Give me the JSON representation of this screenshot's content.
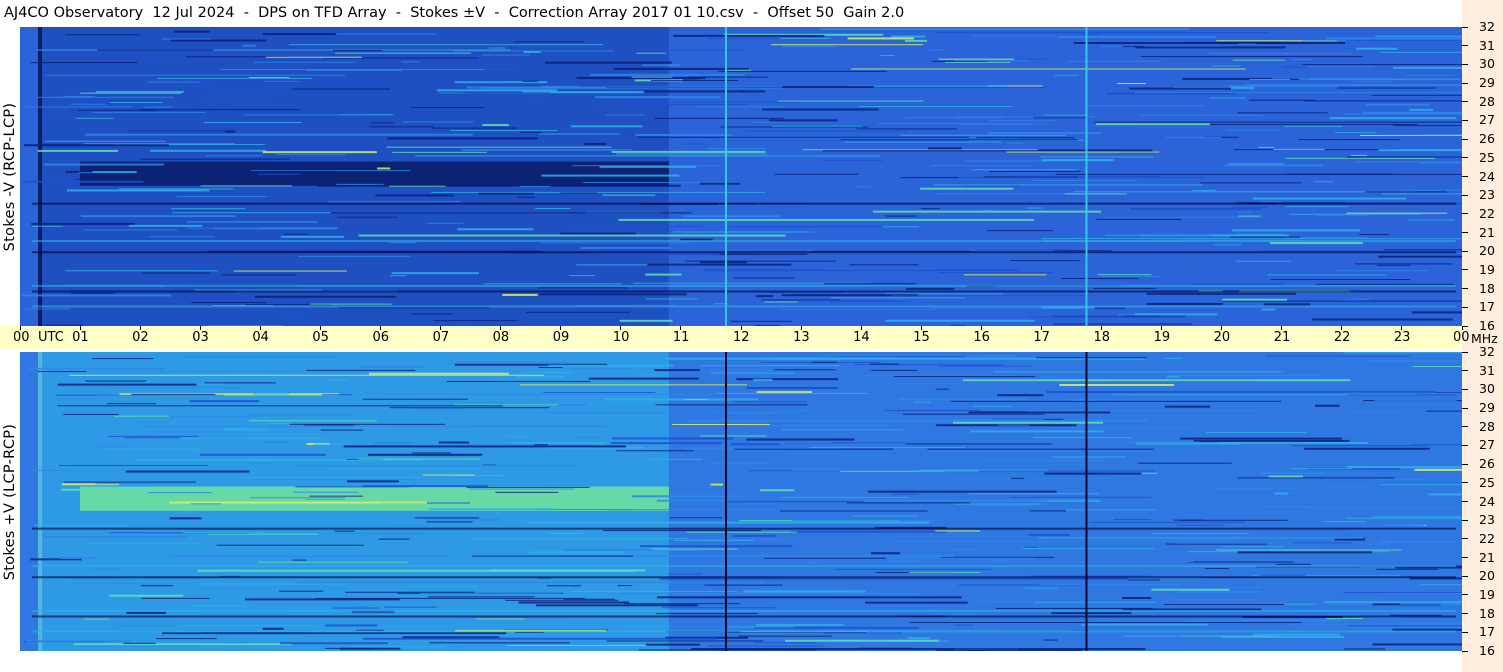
{
  "title": "AJ4CO Observatory  12 Jul 2024  -  DPS on TFD Array  -  Stokes ±V  -  Correction Array 2017 01 10.csv  -  Offset 50  Gain 2.0",
  "colors": {
    "background": "#ffffff",
    "time_axis_bg": "#ffffc8",
    "freq_axis_bg": "#ffeedd",
    "colormap": [
      "#000033",
      "#0a1e7a",
      "#1f4fd0",
      "#2e86ea",
      "#30b0e6",
      "#5ee0b0",
      "#d8f060",
      "#ff40c0"
    ]
  },
  "chart_data": [
    {
      "type": "heatmap",
      "title": "Stokes -V (RCP-LCP)",
      "ylabel": "Stokes -V (RCP-LCP)",
      "x_ticks": [
        "00",
        "01",
        "02",
        "03",
        "04",
        "05",
        "06",
        "07",
        "08",
        "09",
        "10",
        "11",
        "12",
        "13",
        "14",
        "15",
        "16",
        "17",
        "18",
        "19",
        "20",
        "21",
        "22",
        "23",
        "00"
      ],
      "x_unit": "UTC",
      "y_ticks": [
        16,
        17,
        18,
        19,
        20,
        21,
        22,
        23,
        24,
        25,
        26,
        27,
        28,
        29,
        30,
        31,
        32
      ],
      "y_unit": "MHz",
      "xlim": [
        0,
        24
      ],
      "ylim": [
        16,
        32
      ],
      "vertical_markers_utc": [
        11.75,
        17.75
      ],
      "features": {
        "dark_band_utc": [
          1.0,
          10.8
        ],
        "dark_band_mhz": [
          23.5,
          24.8
        ],
        "scan_transition_utc": 10.8
      }
    },
    {
      "type": "heatmap",
      "title": "Stokes +V (LCP-RCP)",
      "ylabel": "Stokes +V (LCP-RCP)",
      "x_ticks": [
        "00",
        "01",
        "02",
        "03",
        "04",
        "05",
        "06",
        "07",
        "08",
        "09",
        "10",
        "11",
        "12",
        "13",
        "14",
        "15",
        "16",
        "17",
        "18",
        "19",
        "20",
        "21",
        "22",
        "23",
        "00"
      ],
      "x_unit": "UTC",
      "y_ticks": [
        16,
        17,
        18,
        19,
        20,
        21,
        22,
        23,
        24,
        25,
        26,
        27,
        28,
        29,
        30,
        31,
        32
      ],
      "y_unit": "MHz",
      "xlim": [
        0,
        24
      ],
      "ylim": [
        16,
        32
      ],
      "vertical_markers_utc": [
        11.75,
        17.75
      ],
      "features": {
        "bright_band_utc": [
          1.0,
          10.8
        ],
        "bright_band_mhz": [
          23.5,
          24.8
        ],
        "scan_transition_utc": 10.8
      }
    }
  ]
}
